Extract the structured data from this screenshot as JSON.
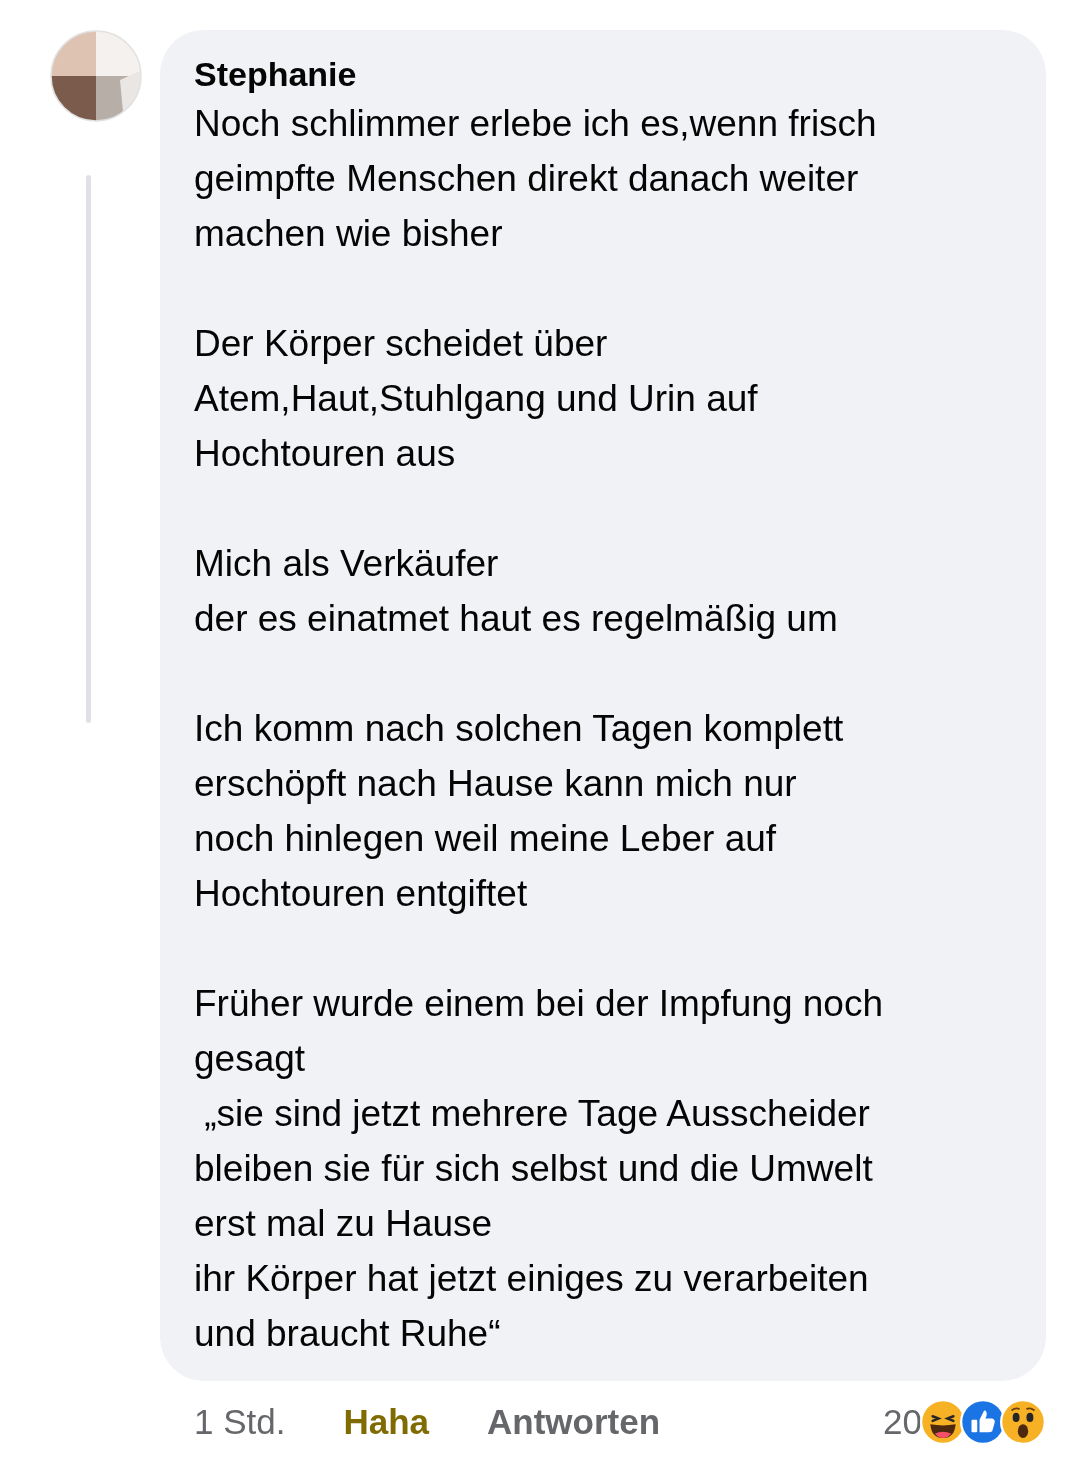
{
  "comment": {
    "author": "Stephanie",
    "paragraphs": [
      "Noch schlimmer erlebe ich es,wenn frisch\ngeimpfte Menschen direkt danach weiter\nmachen wie bisher",
      "Der Körper scheidet über\nAtem,Haut,Stuhlgang und Urin auf\nHochtouren aus",
      "Mich als Verkäufer\nder es einatmet haut es regelmäßig um",
      "Ich komm nach solchen Tagen komplett\nerschöpft nach Hause kann mich nur\nnoch hinlegen weil meine Leber auf\nHochtouren entgiftet",
      "Früher wurde einem bei der Impfung noch\ngesagt\n „sie sind jetzt mehrere Tage Ausscheider\nbleiben sie für sich selbst und die Umwelt\nerst mal zu Hause\nihr Körper hat jetzt einiges zu verarbeiten\nund braucht Ruhe“"
    ],
    "time": "1 Std.",
    "actions": [
      {
        "label": "Haha",
        "selected": true
      },
      {
        "label": "Antworten",
        "selected": false
      }
    ],
    "reaction_count": "20",
    "reactions": [
      {
        "kind": "haha"
      },
      {
        "kind": "like"
      },
      {
        "kind": "wow"
      }
    ]
  }
}
